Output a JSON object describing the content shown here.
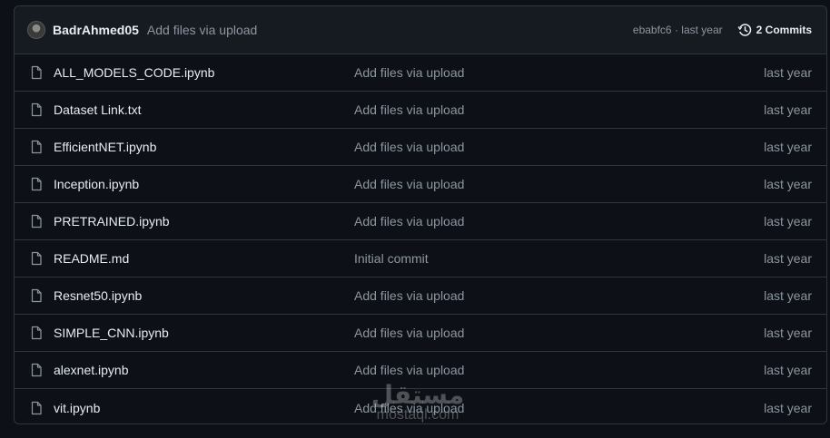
{
  "commit_header": {
    "author": "BadrAhmed05",
    "message": "Add files via upload",
    "hash": "ebabfc6",
    "separator": " · ",
    "time": "last year",
    "commits_label": "2 Commits"
  },
  "files": [
    {
      "name": "ALL_MODELS_CODE.ipynb",
      "message": "Add files via upload",
      "date": "last year"
    },
    {
      "name": "Dataset Link.txt",
      "message": "Add files via upload",
      "date": "last year"
    },
    {
      "name": "EfficientNET.ipynb",
      "message": "Add files via upload",
      "date": "last year"
    },
    {
      "name": "Inception.ipynb",
      "message": "Add files via upload",
      "date": "last year"
    },
    {
      "name": "PRETRAINED.ipynb",
      "message": "Add files via upload",
      "date": "last year"
    },
    {
      "name": "README.md",
      "message": "Initial commit",
      "date": "last year"
    },
    {
      "name": "Resnet50.ipynb",
      "message": "Add files via upload",
      "date": "last year"
    },
    {
      "name": "SIMPLE_CNN.ipynb",
      "message": "Add files via upload",
      "date": "last year"
    },
    {
      "name": "alexnet.ipynb",
      "message": "Add files via upload",
      "date": "last year"
    },
    {
      "name": "vit.ipynb",
      "message": "Add files via upload",
      "date": "last year"
    }
  ],
  "watermark": {
    "arabic": "مستقل",
    "latin": "mostaql.com"
  },
  "icons": {
    "file": "file-icon",
    "history": "history-icon",
    "avatar": "avatar"
  },
  "colors": {
    "background": "#0d1117",
    "header": "#161b22",
    "border": "#30363d",
    "muted": "#8d96a0",
    "text": "#e6edf3"
  }
}
